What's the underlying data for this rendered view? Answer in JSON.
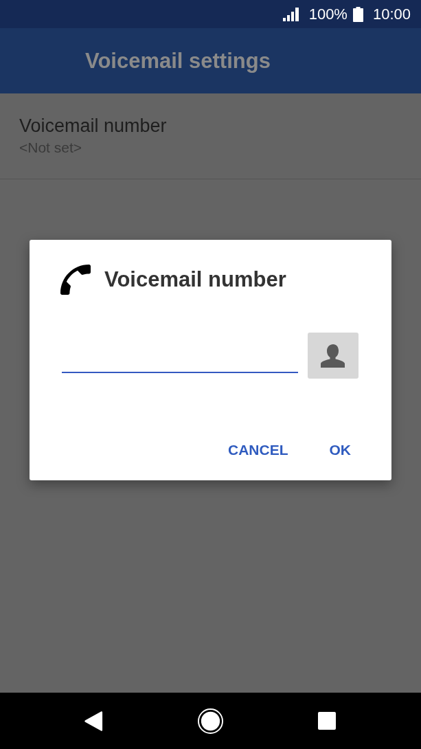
{
  "status_bar": {
    "battery_percent": "100%",
    "time": "10:00"
  },
  "app_bar": {
    "title": "Voicemail settings"
  },
  "settings": [
    {
      "title": "Voicemail number",
      "summary": "<Not set>"
    }
  ],
  "dialog": {
    "title": "Voicemail number",
    "number_field": {
      "focused": true
    },
    "buttons": [
      {
        "label": "CANCEL"
      },
      {
        "label": "OK"
      }
    ]
  }
}
